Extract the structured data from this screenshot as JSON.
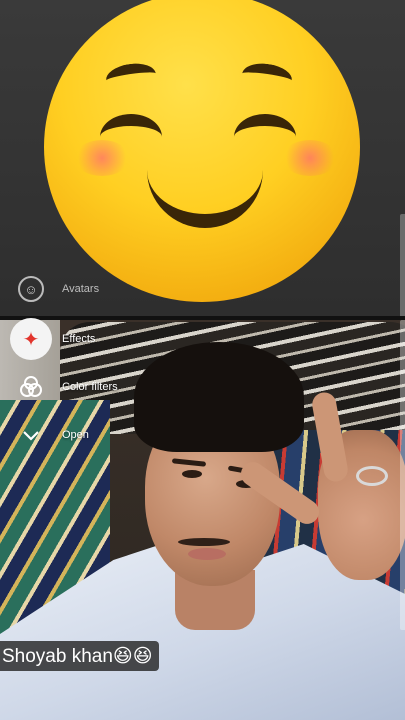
{
  "top_panel": {
    "avatars_label": "Avatars",
    "avatars_icon": "avatar-face-icon"
  },
  "menu": {
    "items": [
      {
        "label": "Effects",
        "icon": "sparkles-icon",
        "active": true
      },
      {
        "label": "Color filters",
        "icon": "color-filters-icon",
        "active": false
      },
      {
        "label": "Open",
        "icon": "chevron-down-icon",
        "active": false
      }
    ]
  },
  "caption": {
    "text": "Shoyab khan😆😆"
  },
  "colors": {
    "effects_icon": "#e2342c",
    "emoji_yellow": "#ffcf22",
    "overlay_text": "#ffffff"
  }
}
